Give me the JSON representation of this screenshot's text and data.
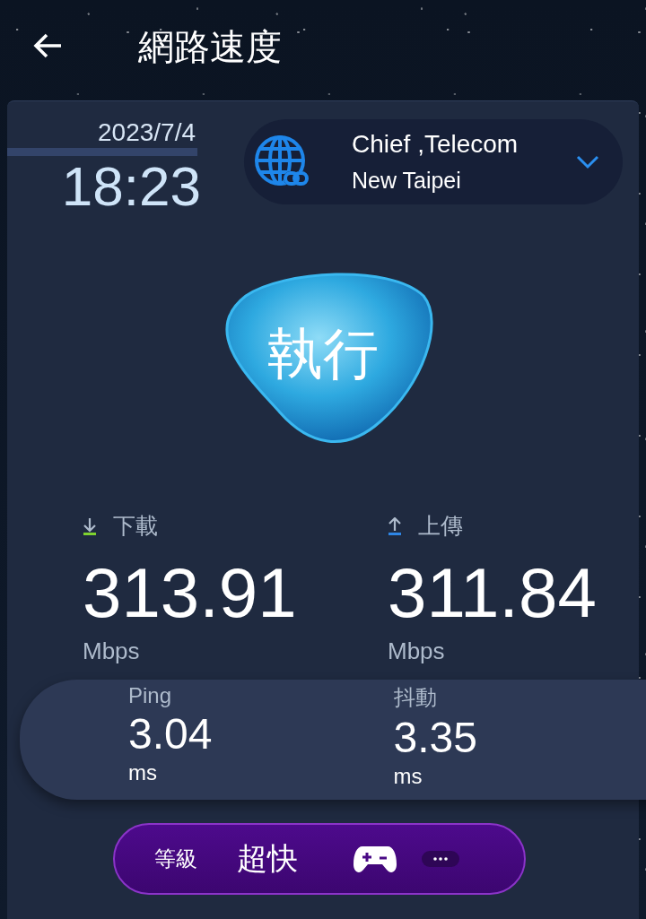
{
  "header": {
    "title": "網路速度"
  },
  "test": {
    "date": "2023/7/4",
    "time": "18:23"
  },
  "network": {
    "provider": "Chief ,Telecom",
    "location": "New Taipei"
  },
  "run_button": {
    "label": "執行"
  },
  "speeds": [
    {
      "kind": "download",
      "label": "下載",
      "value": "313.91",
      "unit": "Mbps"
    },
    {
      "kind": "upload",
      "label": "上傳",
      "value": "311.84",
      "unit": "Mbps"
    }
  ],
  "latency": [
    {
      "label": "Ping",
      "value": "3.04",
      "unit": "ms"
    },
    {
      "label": "抖動",
      "value": "3.35",
      "unit": "ms"
    }
  ],
  "grade": {
    "label": "等級",
    "value": "超快"
  }
}
